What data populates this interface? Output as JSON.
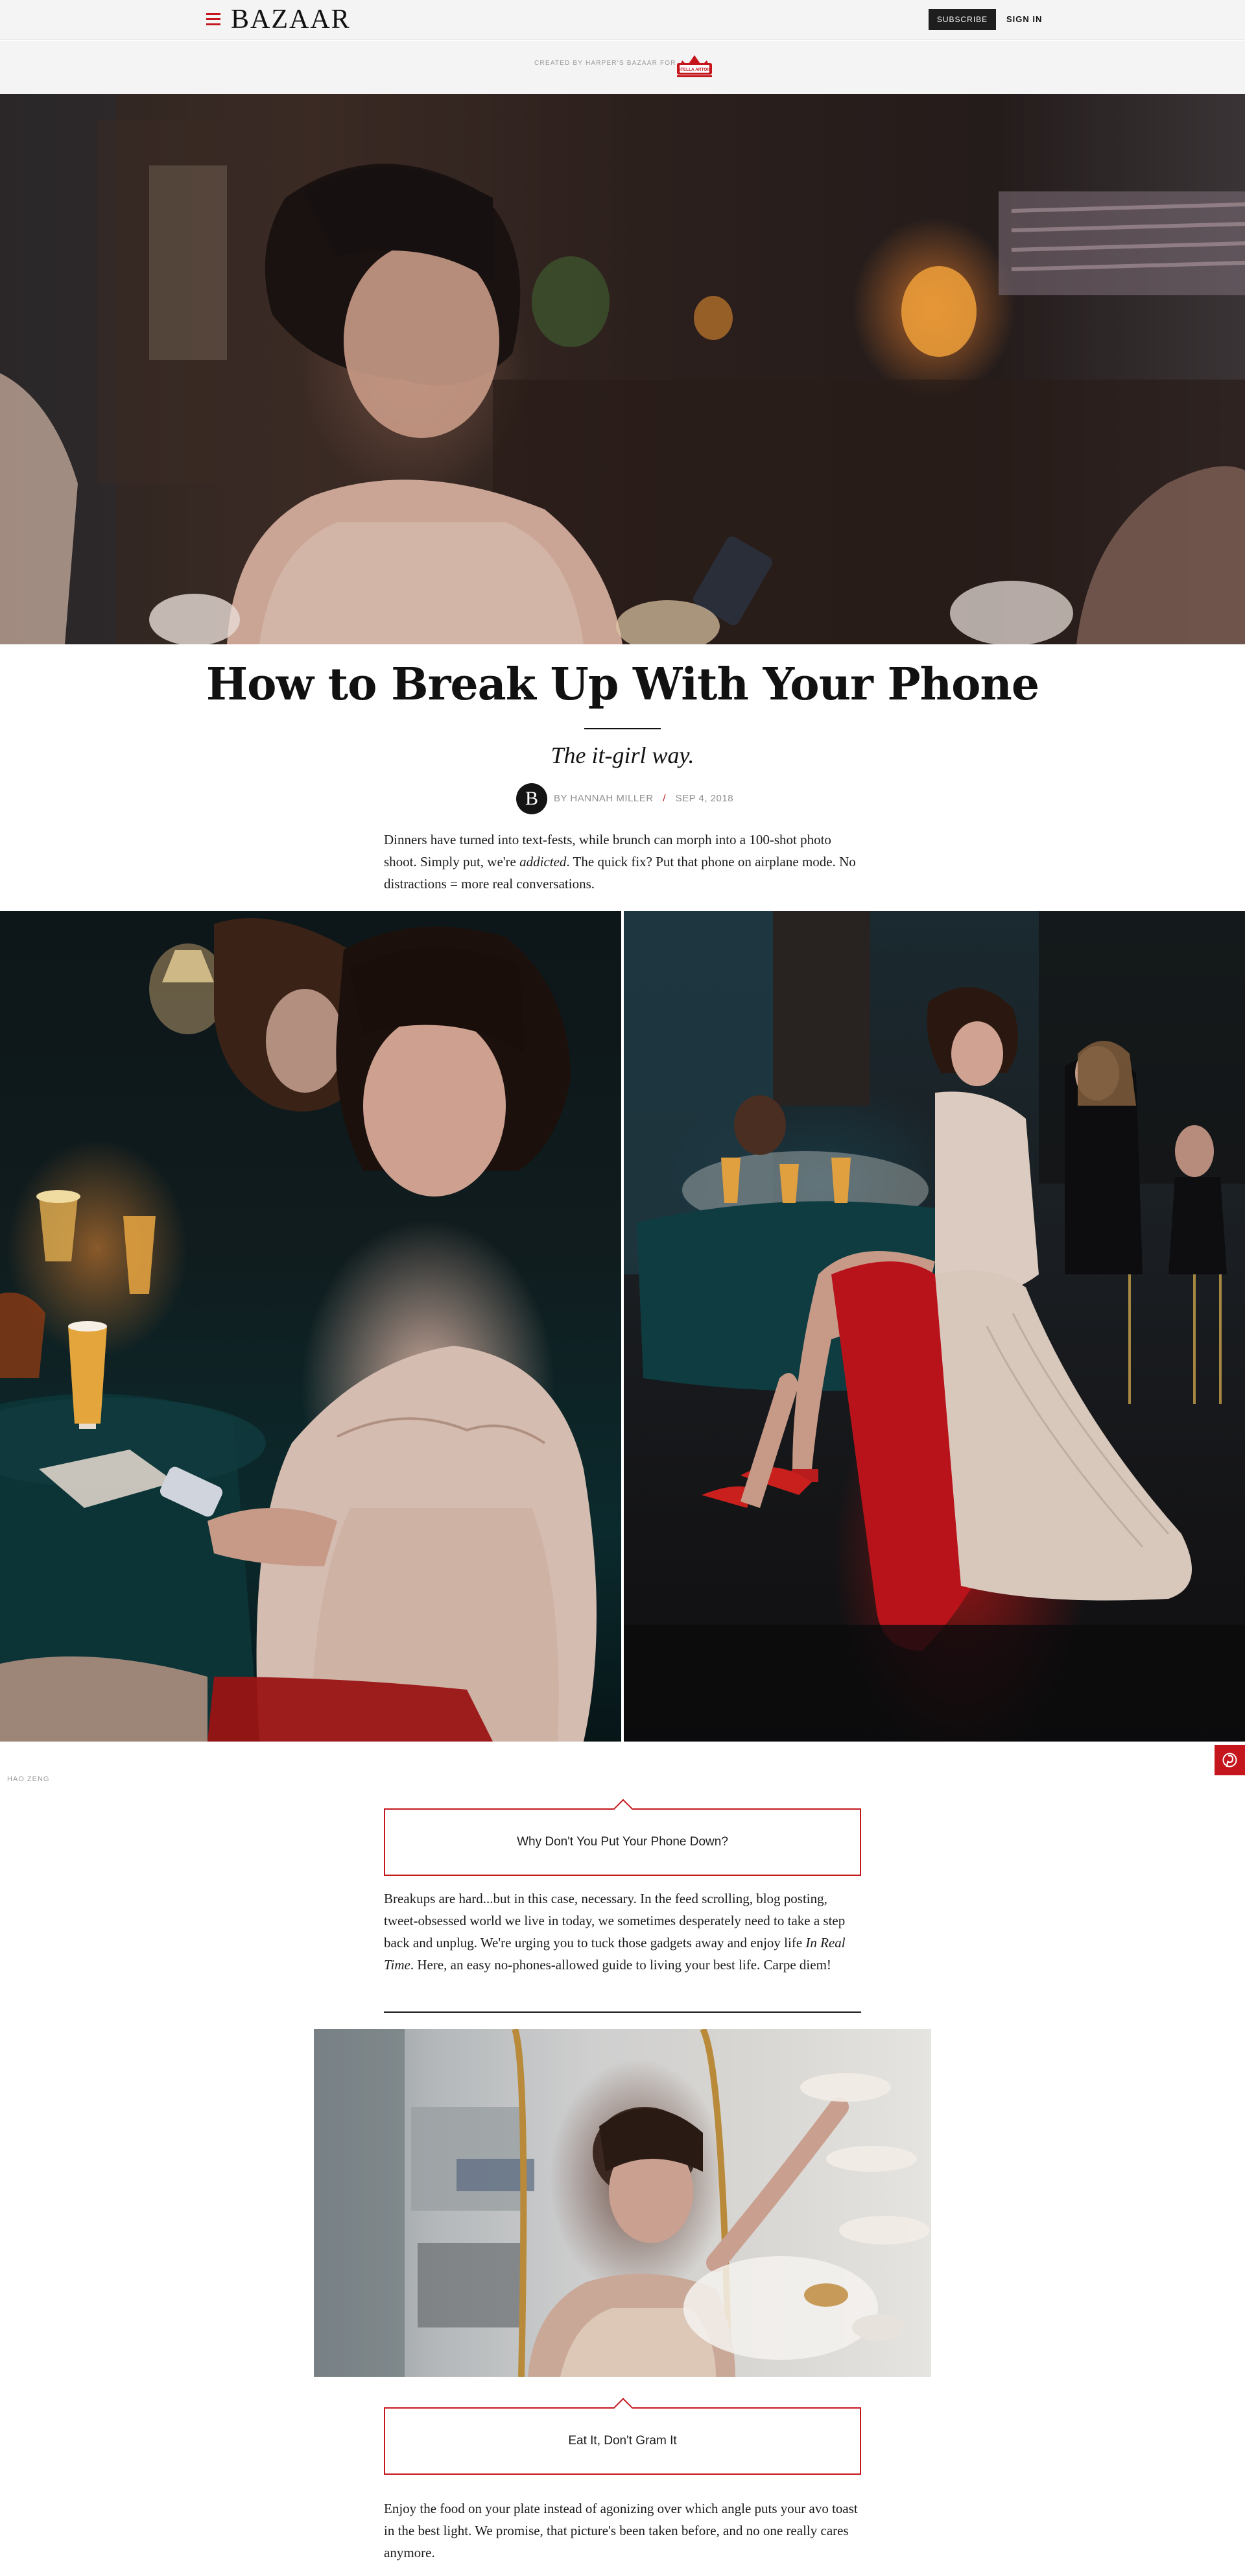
{
  "nav": {
    "logo": "BAZAAR",
    "subscribe": "SUBSCRIBE",
    "signin": "SIGN IN"
  },
  "sponsor": {
    "text": "CREATED BY HARPER'S BAZAAR FOR",
    "brand_logo": "STELLA ARTOIS",
    "brand_color": "#c4161c"
  },
  "article": {
    "title": "How to Break Up With Your Phone",
    "dek": "The it-girl way.",
    "avatar_letter": "B",
    "author": "BY HANNAH MILLER",
    "separator": "/",
    "date": "SEP 4, 2018",
    "intro": {
      "before": "Dinners have turned into text-fests, while brunch can morph into a 100-shot photo shoot. Simply put, we're ",
      "em": "addicted",
      "after": ". The quick fix? Put that phone on airplane mode. No distractions = more real conversations."
    },
    "photo_credit": "HAO ZENG",
    "section1": {
      "heading": "Why Don't You Put Your Phone Down?",
      "body_before": "Breakups are hard...but in this case, necessary. In the feed scrolling, blog posting, tweet-obsessed world we live in today, we sometimes desperately need to take a step back and unplug. We're urging you to tuck those gadgets away and enjoy life ",
      "body_em": "In Real Time",
      "body_after": ". Here, an easy no-phones-allowed guide to living your best life. Carpe diem!"
    },
    "section2": {
      "heading": "Eat It, Don't Gram It",
      "body": "Enjoy the food on your plate instead of agonizing over which angle puts your avo toast in the best light. We promise, that picture's been taken before, and no one really cares anymore."
    }
  },
  "icons": {
    "menu": "hamburger-menu-icon",
    "pinterest": "pinterest-icon"
  },
  "colors": {
    "accent": "#c4161c",
    "nav_bg": "#f4f4f4",
    "subscribe_bg": "#1e1e1e"
  }
}
